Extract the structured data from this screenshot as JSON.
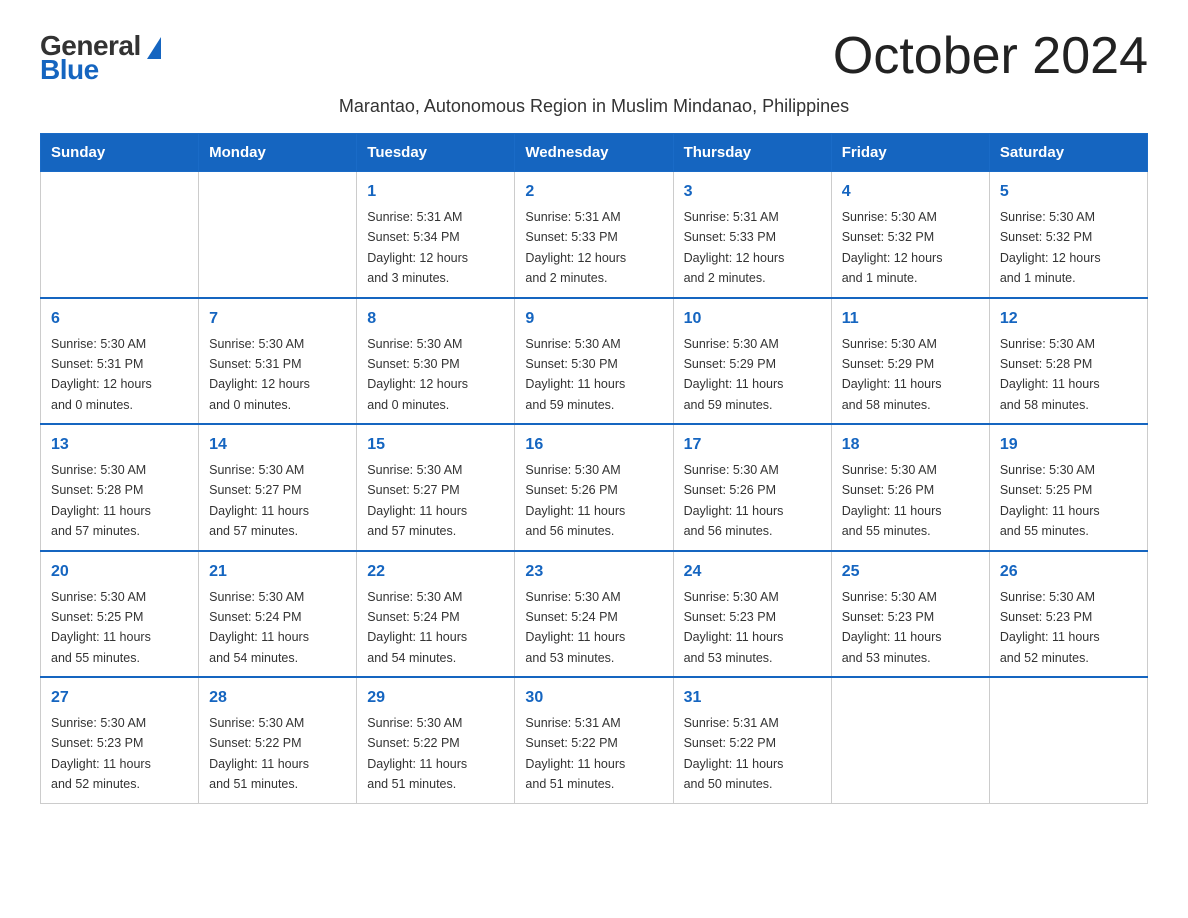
{
  "logo": {
    "general": "General",
    "blue": "Blue"
  },
  "title": "October 2024",
  "subtitle": "Marantao, Autonomous Region in Muslim Mindanao, Philippines",
  "weekdays": [
    "Sunday",
    "Monday",
    "Tuesday",
    "Wednesday",
    "Thursday",
    "Friday",
    "Saturday"
  ],
  "weeks": [
    [
      {
        "day": "",
        "info": ""
      },
      {
        "day": "",
        "info": ""
      },
      {
        "day": "1",
        "info": "Sunrise: 5:31 AM\nSunset: 5:34 PM\nDaylight: 12 hours\nand 3 minutes."
      },
      {
        "day": "2",
        "info": "Sunrise: 5:31 AM\nSunset: 5:33 PM\nDaylight: 12 hours\nand 2 minutes."
      },
      {
        "day": "3",
        "info": "Sunrise: 5:31 AM\nSunset: 5:33 PM\nDaylight: 12 hours\nand 2 minutes."
      },
      {
        "day": "4",
        "info": "Sunrise: 5:30 AM\nSunset: 5:32 PM\nDaylight: 12 hours\nand 1 minute."
      },
      {
        "day": "5",
        "info": "Sunrise: 5:30 AM\nSunset: 5:32 PM\nDaylight: 12 hours\nand 1 minute."
      }
    ],
    [
      {
        "day": "6",
        "info": "Sunrise: 5:30 AM\nSunset: 5:31 PM\nDaylight: 12 hours\nand 0 minutes."
      },
      {
        "day": "7",
        "info": "Sunrise: 5:30 AM\nSunset: 5:31 PM\nDaylight: 12 hours\nand 0 minutes."
      },
      {
        "day": "8",
        "info": "Sunrise: 5:30 AM\nSunset: 5:30 PM\nDaylight: 12 hours\nand 0 minutes."
      },
      {
        "day": "9",
        "info": "Sunrise: 5:30 AM\nSunset: 5:30 PM\nDaylight: 11 hours\nand 59 minutes."
      },
      {
        "day": "10",
        "info": "Sunrise: 5:30 AM\nSunset: 5:29 PM\nDaylight: 11 hours\nand 59 minutes."
      },
      {
        "day": "11",
        "info": "Sunrise: 5:30 AM\nSunset: 5:29 PM\nDaylight: 11 hours\nand 58 minutes."
      },
      {
        "day": "12",
        "info": "Sunrise: 5:30 AM\nSunset: 5:28 PM\nDaylight: 11 hours\nand 58 minutes."
      }
    ],
    [
      {
        "day": "13",
        "info": "Sunrise: 5:30 AM\nSunset: 5:28 PM\nDaylight: 11 hours\nand 57 minutes."
      },
      {
        "day": "14",
        "info": "Sunrise: 5:30 AM\nSunset: 5:27 PM\nDaylight: 11 hours\nand 57 minutes."
      },
      {
        "day": "15",
        "info": "Sunrise: 5:30 AM\nSunset: 5:27 PM\nDaylight: 11 hours\nand 57 minutes."
      },
      {
        "day": "16",
        "info": "Sunrise: 5:30 AM\nSunset: 5:26 PM\nDaylight: 11 hours\nand 56 minutes."
      },
      {
        "day": "17",
        "info": "Sunrise: 5:30 AM\nSunset: 5:26 PM\nDaylight: 11 hours\nand 56 minutes."
      },
      {
        "day": "18",
        "info": "Sunrise: 5:30 AM\nSunset: 5:26 PM\nDaylight: 11 hours\nand 55 minutes."
      },
      {
        "day": "19",
        "info": "Sunrise: 5:30 AM\nSunset: 5:25 PM\nDaylight: 11 hours\nand 55 minutes."
      }
    ],
    [
      {
        "day": "20",
        "info": "Sunrise: 5:30 AM\nSunset: 5:25 PM\nDaylight: 11 hours\nand 55 minutes."
      },
      {
        "day": "21",
        "info": "Sunrise: 5:30 AM\nSunset: 5:24 PM\nDaylight: 11 hours\nand 54 minutes."
      },
      {
        "day": "22",
        "info": "Sunrise: 5:30 AM\nSunset: 5:24 PM\nDaylight: 11 hours\nand 54 minutes."
      },
      {
        "day": "23",
        "info": "Sunrise: 5:30 AM\nSunset: 5:24 PM\nDaylight: 11 hours\nand 53 minutes."
      },
      {
        "day": "24",
        "info": "Sunrise: 5:30 AM\nSunset: 5:23 PM\nDaylight: 11 hours\nand 53 minutes."
      },
      {
        "day": "25",
        "info": "Sunrise: 5:30 AM\nSunset: 5:23 PM\nDaylight: 11 hours\nand 53 minutes."
      },
      {
        "day": "26",
        "info": "Sunrise: 5:30 AM\nSunset: 5:23 PM\nDaylight: 11 hours\nand 52 minutes."
      }
    ],
    [
      {
        "day": "27",
        "info": "Sunrise: 5:30 AM\nSunset: 5:23 PM\nDaylight: 11 hours\nand 52 minutes."
      },
      {
        "day": "28",
        "info": "Sunrise: 5:30 AM\nSunset: 5:22 PM\nDaylight: 11 hours\nand 51 minutes."
      },
      {
        "day": "29",
        "info": "Sunrise: 5:30 AM\nSunset: 5:22 PM\nDaylight: 11 hours\nand 51 minutes."
      },
      {
        "day": "30",
        "info": "Sunrise: 5:31 AM\nSunset: 5:22 PM\nDaylight: 11 hours\nand 51 minutes."
      },
      {
        "day": "31",
        "info": "Sunrise: 5:31 AM\nSunset: 5:22 PM\nDaylight: 11 hours\nand 50 minutes."
      },
      {
        "day": "",
        "info": ""
      },
      {
        "day": "",
        "info": ""
      }
    ]
  ]
}
